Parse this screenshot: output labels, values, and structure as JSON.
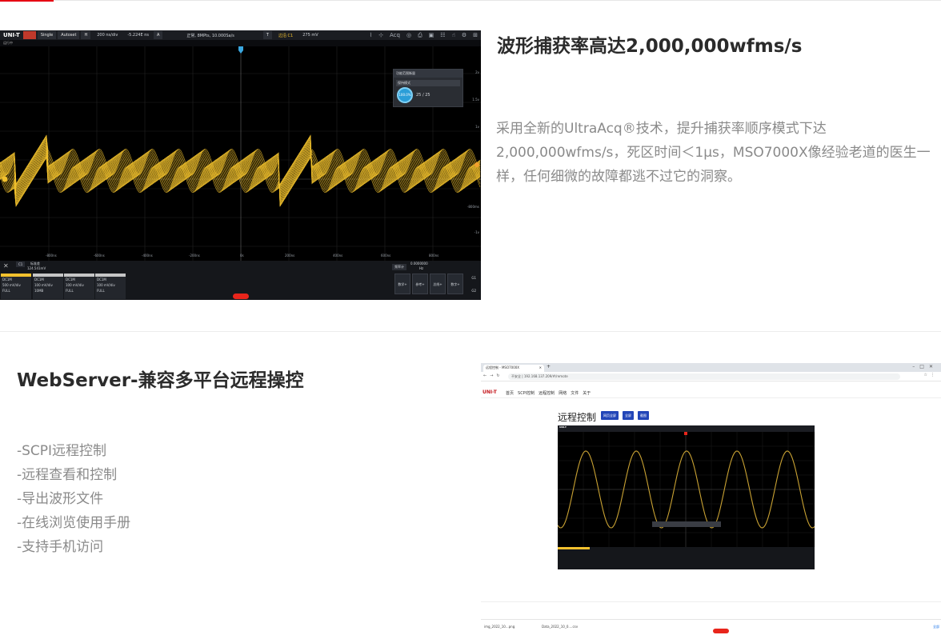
{
  "section1": {
    "title": "波形捕获率高达2,000,000wfms/s",
    "description": "采用全新的UltraAcq®技术，提升捕获率顺序模式下达2,000,000wfms/s，死区时间＜1μs，MSO7000X像经验老道的医生一样，任何细微的故障都逃不过它的洞察。",
    "scope": {
      "logo": "UNI-T",
      "single": "Single",
      "autoset": "Autoset",
      "h_label": "H",
      "timebase": "200 ns/div",
      "offset": "-5.224E ns",
      "acq_a": "A",
      "sample_rate": "正常, 8MPts, 10.000Sa/s",
      "trig_label": "T",
      "trig_info": "边沿 C1",
      "trig_level": "275 mV",
      "acq_btn": "Acq",
      "sub_label": "运行中",
      "panel_title": "功能范围衡量",
      "panel_row": "保持模式",
      "panel_dial": "100.0%",
      "panel_count": "25 / 25",
      "x_ticks": [
        "-800ns",
        "-600ns",
        "-400ns",
        "-200ns",
        "0s",
        "200ns",
        "400ns",
        "600ns",
        "800ns"
      ],
      "y_ticks": [
        "2v",
        "1.5v",
        "1v",
        "-800ms",
        "-1v"
      ],
      "readout_label": "标准差",
      "readout_ch": "C1",
      "readout_value": "124.541mV",
      "freq_label": "频率计",
      "freq_value": "0.0000000",
      "freq_unit": "Hz",
      "channels": [
        {
          "name": "C1",
          "mode": "DC1M",
          "scale": "500 mV/div",
          "bw": "FULL",
          "probe": "1X",
          "color": "#f2c12e"
        },
        {
          "name": "C2",
          "mode": "DC1M",
          "scale": "100 mV/div",
          "bw": "10MB",
          "probe": "1X",
          "color": "#c6c6c6"
        },
        {
          "name": "C3",
          "mode": "DC1M",
          "scale": "100 mV/div",
          "bw": "FULL",
          "probe": "1X",
          "color": "#c6c6c6"
        },
        {
          "name": "C4",
          "mode": "DC1M",
          "scale": "100 mV/div",
          "bw": "FULL",
          "probe": "1X",
          "color": "#c6c6c6"
        }
      ],
      "bottom_buttons": [
        "数学+",
        "参考+",
        "总线+",
        "数字+"
      ],
      "g1": "G1",
      "g2": "G2"
    }
  },
  "section2": {
    "title": "WebServer-兼容多平台远程操控",
    "features": [
      "-SCPI远程控制",
      "-远程查看和控制",
      "-导出波形文件",
      "-在线浏览使用手册",
      "-支持手机访问"
    ],
    "browser": {
      "tab_title": "远程控制 - MSO7000X",
      "url": "不安全 | 192.168.137.209/#/remote",
      "site_logo": "UNI-T",
      "nav_links": [
        "首页",
        "SCPI控制",
        "远程控制",
        "网络",
        "文件",
        "关于"
      ],
      "remote_title": "远程控制",
      "remote_buttons": [
        "网页全屏",
        "全屏",
        "截图"
      ],
      "mini_logo": "UNI-T",
      "downloads": [
        "img_2022_10...png",
        "Data_2022_10_0....csv"
      ],
      "download_all": "全部"
    }
  }
}
